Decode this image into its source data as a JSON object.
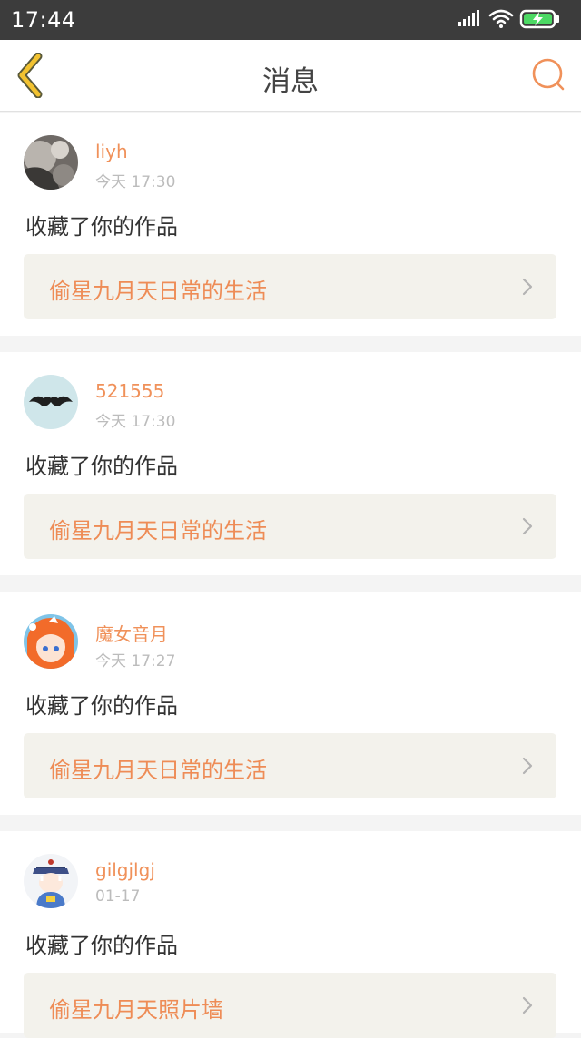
{
  "status_bar": {
    "time": "17:44"
  },
  "header": {
    "title": "消息"
  },
  "messages": [
    {
      "username": "liyh",
      "time": "今天 17:30",
      "action": "收藏了你的作品",
      "work_title": "偷星九月天日常的生活"
    },
    {
      "username": "521555",
      "time": "今天 17:30",
      "action": "收藏了你的作品",
      "work_title": "偷星九月天日常的生活"
    },
    {
      "username": "魔女音月",
      "time": "今天 17:27",
      "action": "收藏了你的作品",
      "work_title": "偷星九月天日常的生活"
    },
    {
      "username": "gilgjlgj",
      "time": "01-17",
      "action": "收藏了你的作品",
      "work_title": "偷星九月天照片墙"
    }
  ],
  "colors": {
    "accent": "#f0915a",
    "status_bar": "#3c3c3c",
    "link_bg": "#f3f2ec",
    "back_icon": "#f2c230"
  },
  "icons": {
    "back": "chevron-left-icon",
    "search": "search-icon",
    "signal": "signal-icon",
    "wifi": "wifi-icon",
    "battery": "battery-charging-icon",
    "link_arrow": "chevron-right-icon"
  }
}
